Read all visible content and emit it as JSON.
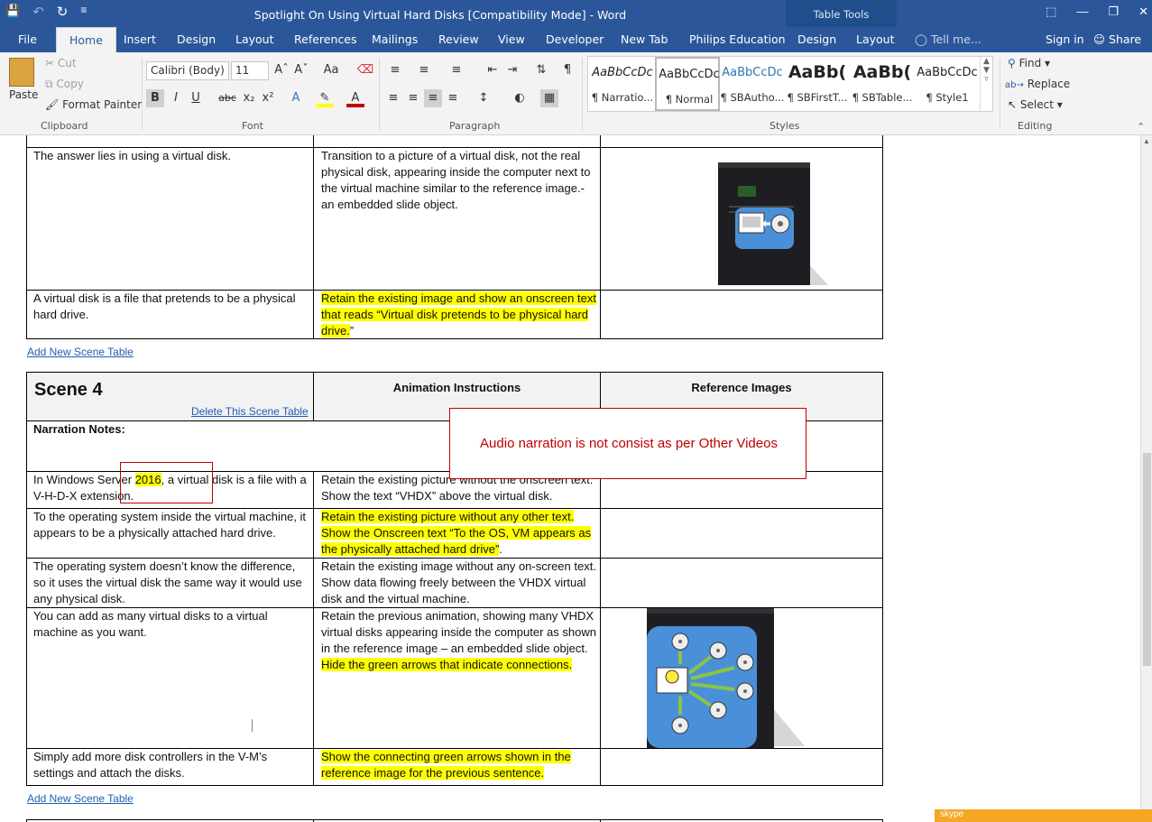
{
  "window": {
    "title": "Spotlight On Using Virtual Hard Disks [Compatibility Mode] - Word",
    "contextual_group": "Table Tools",
    "controls": {
      "ribbon_display": "⬚",
      "minimize": "—",
      "restore": "❐",
      "close": "✕"
    }
  },
  "qat": {
    "save": "💾",
    "undo": "↶",
    "redo": "↻",
    "customize": "≡"
  },
  "tabs": [
    "File",
    "Home",
    "Insert",
    "Design",
    "Layout",
    "References",
    "Mailings",
    "Review",
    "View",
    "Developer",
    "New Tab",
    "Philips Education",
    "Design",
    "Layout"
  ],
  "tell_me": "Tell me...",
  "sign_in": "Sign in",
  "share": "Share",
  "ribbon": {
    "clipboard": {
      "paste": "Paste",
      "cut": "Cut",
      "copy": "Copy",
      "format_painter": "Format Painter",
      "label": "Clipboard"
    },
    "font": {
      "name": "Calibri (Body)",
      "size": "11",
      "label": "Font"
    },
    "paragraph": {
      "label": "Paragraph"
    },
    "styles": {
      "label": "Styles",
      "items": [
        {
          "sample": "AaBbCcDc",
          "name": "¶ Narratio..."
        },
        {
          "sample": "AaBbCcDc",
          "name": "¶ Normal"
        },
        {
          "sample": "AaBbCcDc",
          "name": "¶ SBAutho..."
        },
        {
          "sample": "AaBb(",
          "name": "¶ SBFirstT..."
        },
        {
          "sample": "AaBb(",
          "name": "¶ SBTable..."
        },
        {
          "sample": "AaBbCcDc",
          "name": "¶ Style1"
        }
      ]
    },
    "editing": {
      "find": "Find",
      "replace": "Replace",
      "select": "Select",
      "label": "Editing"
    }
  },
  "document": {
    "table1_rows": [
      {
        "narration": "The answer lies in using a virtual disk.",
        "animation": "Transition to a picture of a virtual disk, not the real physical disk, appearing inside the computer next to the virtual machine similar to the reference image.- an embedded slide object."
      },
      {
        "narration": "A virtual disk is a file that pretends to be a physical hard drive.",
        "animation_hl": "Retain the existing image and show an onscreen text that reads “Virtual disk pretends to be physical hard drive.",
        "animation_tail": "”"
      }
    ],
    "add_scene_link": "Add New Scene Table",
    "scene4": {
      "title": "Scene 4",
      "delete_link": "Delete This Scene Table",
      "col_animation": "Animation Instructions",
      "col_reference": "Reference Images",
      "narration_notes": "Narration Notes:",
      "rows": [
        {
          "narration_pre": "In Windows Server ",
          "narration_hl": "2016",
          "narration_post": ", a virtual disk is a file with a V-H-D-X extension.",
          "animation": "Retain the existing picture without the onscreen text. Show the text “VHDX” above the virtual disk."
        },
        {
          "narration": "To the operating system inside the virtual machine, it appears to be a physically attached hard drive.",
          "animation_hl": "Retain the existing picture without any other text. Show the Onscreen text “To the OS, VM appears as the physically attached hard drive”",
          "animation_tail": "."
        },
        {
          "narration": "The operating system doesn’t know the difference, so it uses the virtual disk the same way it would use any physical disk.",
          "animation": "Retain the existing image without any on-screen text. Show data flowing freely between the VHDX virtual disk and the virtual machine."
        },
        {
          "narration": "You can add as many virtual disks to a virtual machine as you want.",
          "animation_pre": "Retain the previous animation, showing many VHDX virtual disks appearing inside the computer as shown in the reference image – an embedded slide object. ",
          "animation_hl": "Hide the green arrows that indicate connections."
        },
        {
          "narration": "Simply add more disk controllers in the V-M’s settings and attach the disks.",
          "animation_hl": "Show the connecting green arrows shown in the reference image for the previous sentence."
        }
      ]
    },
    "comment": "Audio narration is not consist as per Other Videos"
  },
  "skype_label": "skype"
}
